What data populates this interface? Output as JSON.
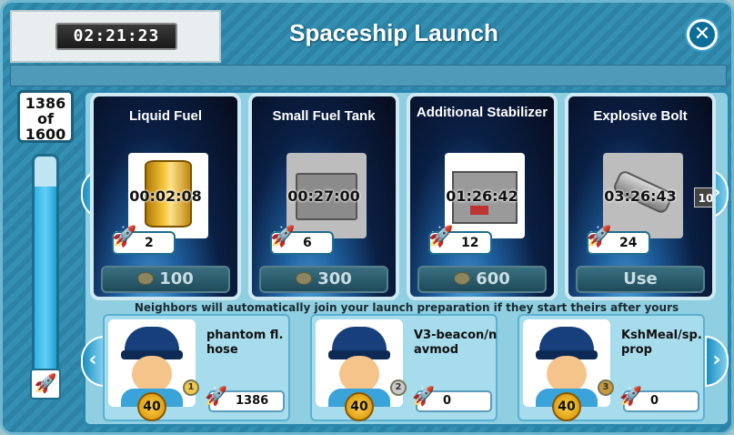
{
  "header": {
    "timer": "02:21:23",
    "title": "Spaceship Launch",
    "close_icon": "close-icon"
  },
  "progress": {
    "count": "1386",
    "of": "of",
    "total": "1600",
    "fraction": 0.866
  },
  "cards": [
    {
      "name": "Liquid Fuel",
      "time": "00:02:08",
      "rockets": "2",
      "button": "100",
      "button_coin": true
    },
    {
      "name": "Small Fuel Tank",
      "time": "00:27:00",
      "rockets": "6",
      "button": "300",
      "button_coin": true
    },
    {
      "name": "Additional Stabilizer",
      "time": "01:26:42",
      "rockets": "12",
      "button": "600",
      "button_coin": true
    },
    {
      "name": "Explosive Bolt",
      "time": "03:26:43",
      "rockets": "24",
      "button": "Use",
      "badge": "10"
    }
  ],
  "notice": "Neighbors will automatically join your launch preparation if they start theirs after yours",
  "neighbors": [
    {
      "name": "phantom fl.hose",
      "level": "40",
      "rank": "1",
      "score": "1386"
    },
    {
      "name": "V3-beacon/navmod",
      "level": "40",
      "rank": "2",
      "score": "0"
    },
    {
      "name": "KshMeal/sp.prop",
      "level": "40",
      "rank": "3",
      "score": "0"
    }
  ]
}
